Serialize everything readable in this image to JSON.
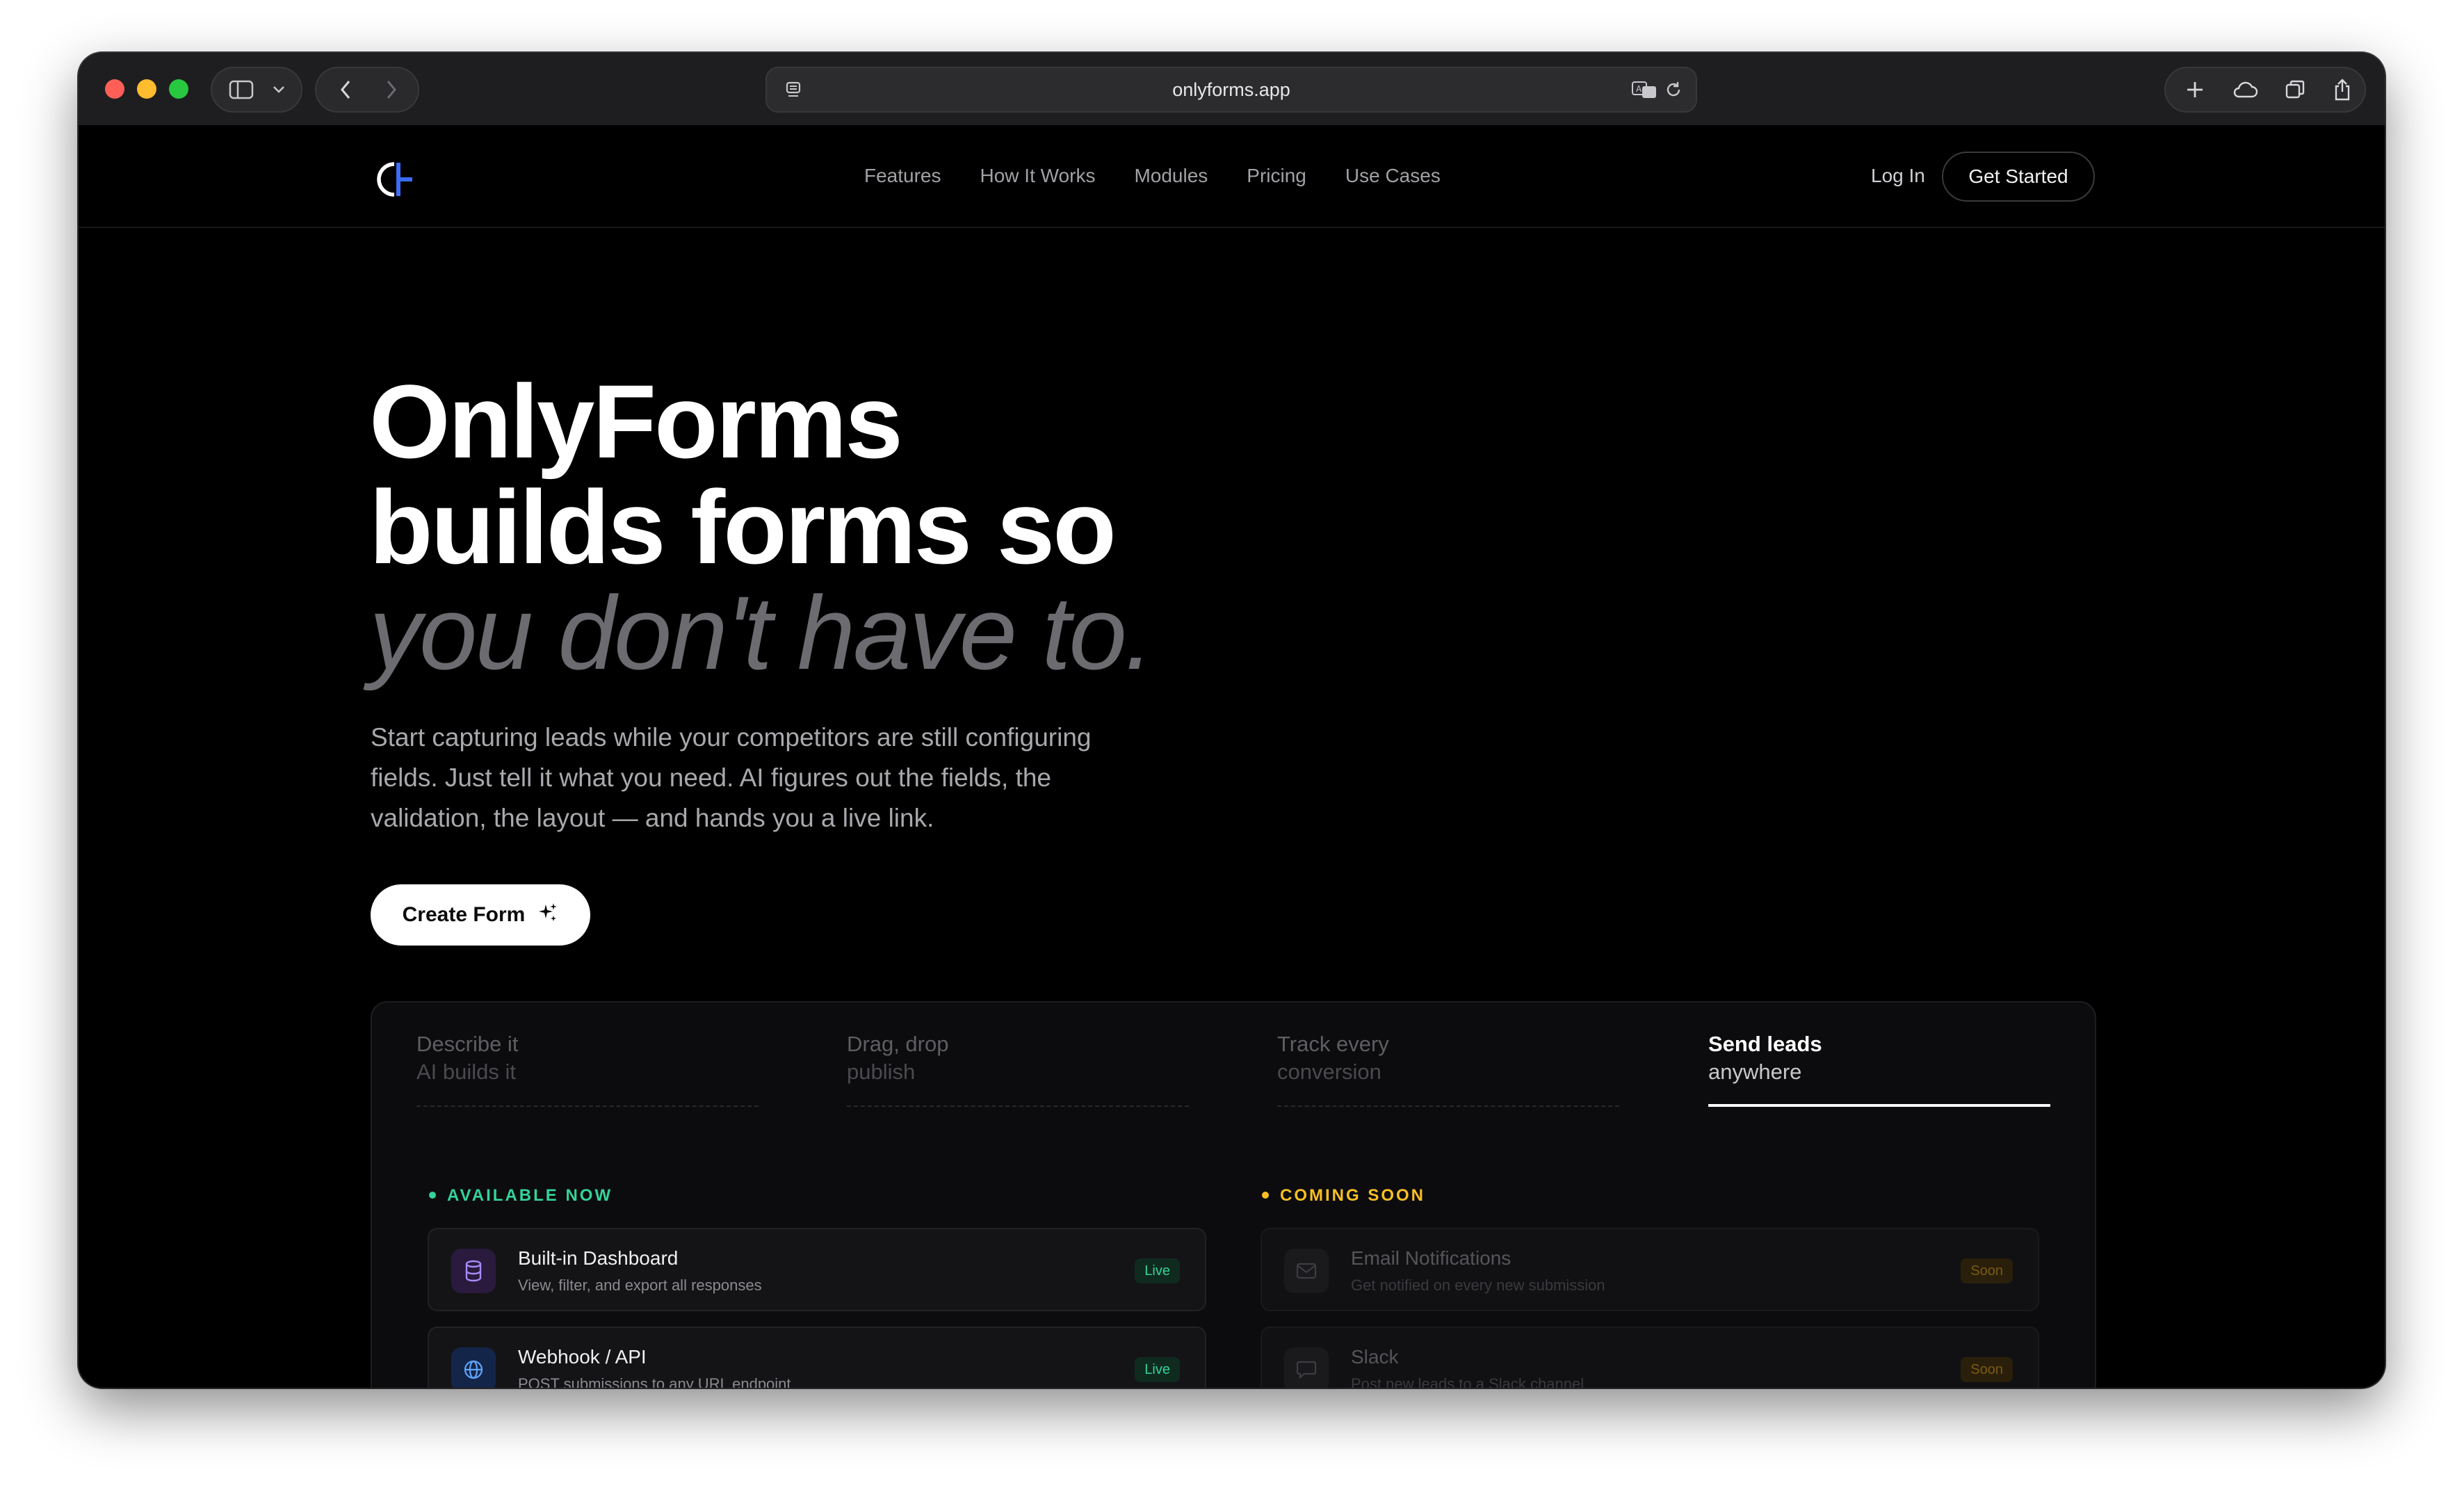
{
  "browser": {
    "url": "onlyforms.app"
  },
  "nav": {
    "links": [
      "Features",
      "How It Works",
      "Modules",
      "Pricing",
      "Use Cases"
    ],
    "login": "Log In",
    "cta": "Get Started"
  },
  "hero": {
    "title_line1": "OnlyForms",
    "title_line2": "builds forms so",
    "title_line3": "you don't have to.",
    "subtitle": "Start capturing leads while your competitors are still configuring fields. Just tell it what you need. AI figures out the fields, the validation, the layout — and hands you a live link.",
    "create_button": "Create Form"
  },
  "tabs": [
    {
      "line1": "Describe it",
      "line2": "AI builds it",
      "active": false
    },
    {
      "line1": "Drag, drop",
      "line2": "publish",
      "active": false
    },
    {
      "line1": "Track every",
      "line2": "conversion",
      "active": false
    },
    {
      "line1": "Send leads",
      "line2": "anywhere",
      "active": true
    }
  ],
  "available": {
    "label": "AVAILABLE NOW",
    "items": [
      {
        "title": "Built-in Dashboard",
        "desc": "View, filter, and export all responses",
        "badge": "Live",
        "icon": "database-icon"
      },
      {
        "title": "Webhook / API",
        "desc": "POST submissions to any URL endpoint",
        "badge": "Live",
        "icon": "globe-icon"
      }
    ]
  },
  "coming_soon": {
    "label": "COMING SOON",
    "items": [
      {
        "title": "Email Notifications",
        "desc": "Get notified on every new submission",
        "badge": "Soon",
        "icon": "mail-icon"
      },
      {
        "title": "Slack",
        "desc": "Post new leads to a Slack channel",
        "badge": "Soon",
        "icon": "chat-icon"
      }
    ]
  },
  "colors": {
    "accent_green": "#34d399",
    "accent_amber": "#fbbf24",
    "logo_blue": "#3b6cf6"
  }
}
